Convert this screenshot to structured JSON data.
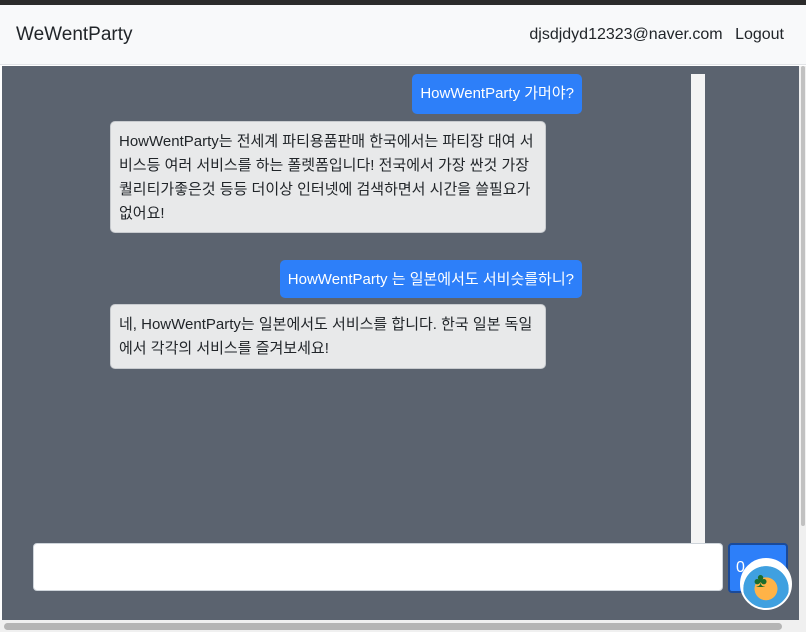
{
  "nav": {
    "brand": "WeWentParty",
    "user_email": "djsdjdyd12323@naver.com",
    "logout": "Logout"
  },
  "chat": {
    "messages": [
      {
        "role": "user",
        "text": "HowWentParty 가머야?"
      },
      {
        "role": "bot",
        "text": "HowWentParty는 전세계 파티용품판매 한국에서는 파티장 대여 서비스등 여러 서비스를 하는 폴렛폼입니다! 전국에서 가장 싼것 가장 퀄리티가좋은것 등등 더이상 인터넷에 검색하면서 시간을 쓸필요가 없어요!"
      },
      {
        "role": "user",
        "text": "HowWentParty 는 일본에서도 서비슷를하니?"
      },
      {
        "role": "bot",
        "text": "네, HowWentParty는 일본에서도 서비스를 합니다. 한국 일본 독일에서 각각의 서비스를 즐겨보세요!"
      }
    ]
  },
  "input": {
    "value": "",
    "send_label": "0"
  },
  "colors": {
    "chat_background": "#5b636f",
    "user_bubble": "#2d7ff9",
    "bot_bubble": "#e8e9ea"
  },
  "icons": {
    "avatar": "palm-island-icon"
  }
}
